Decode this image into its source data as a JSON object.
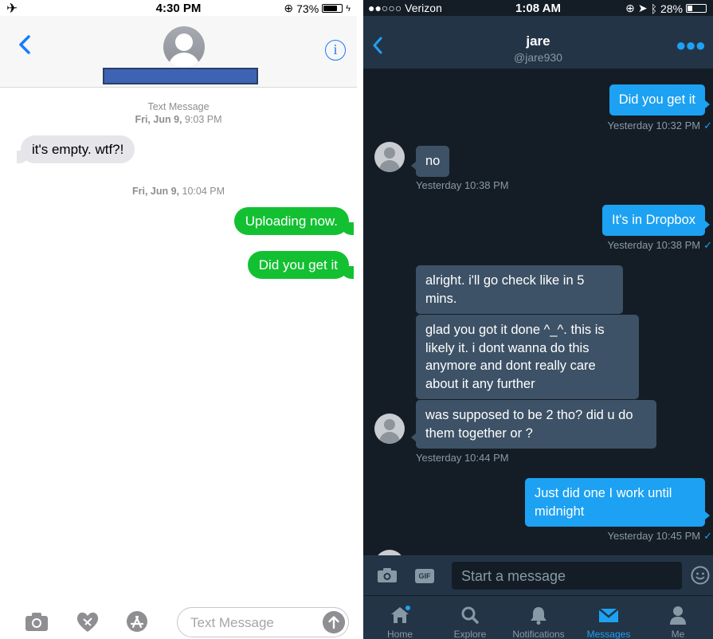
{
  "left": {
    "status": {
      "time": "4:30 PM",
      "battery": "73%",
      "battery_level": 0.73
    },
    "thread_header": "Text Message",
    "messages": [
      {
        "meta_day": "Fri, Jun 9,",
        "meta_time": "9:03 PM"
      },
      {
        "text": "it's empty. wtf?!",
        "direction": "incoming"
      },
      {
        "meta_day": "Fri, Jun 9,",
        "meta_time": "10:04 PM"
      },
      {
        "text": "Uploading now.",
        "direction": "outgoing"
      },
      {
        "text": "Did you get it",
        "direction": "outgoing"
      }
    ],
    "input_placeholder": "Text Message",
    "icons": [
      "camera-icon",
      "digital-touch-icon",
      "app-store-icon",
      "send-arrow-icon",
      "info-icon",
      "back-chevron-icon"
    ],
    "colors": {
      "accent": "#157efb",
      "outgoing": "#13c032",
      "incoming": "#e5e5ea"
    }
  },
  "right": {
    "status": {
      "carrier": "●●○○○ Verizon",
      "time": "1:08 AM",
      "battery": "28%",
      "battery_level": 0.28
    },
    "contact": {
      "name": "jare",
      "handle": "@jare930"
    },
    "messages": [
      {
        "text": "Did you get it",
        "direction": "outgoing",
        "time": "Yesterday 10:32 PM"
      },
      {
        "text": "no",
        "direction": "incoming",
        "time": "Yesterday 10:38 PM"
      },
      {
        "text": "It's in Dropbox",
        "direction": "outgoing",
        "time": "Yesterday 10:38 PM"
      },
      {
        "text": "alright. i'll go check like in 5 mins.",
        "direction": "incoming"
      },
      {
        "text": "glad you got it done ^_^. this is likely it. i dont wanna do this anymore and dont really care about it any further",
        "direction": "incoming"
      },
      {
        "text": "was supposed to be 2 tho? did u do them together or ?",
        "direction": "incoming",
        "time": "Yesterday 10:44 PM"
      },
      {
        "text": "Just did one I work until midnight",
        "direction": "outgoing",
        "time": "Yesterday 10:45 PM"
      }
    ],
    "composer": {
      "placeholder": "Start a message",
      "gif_label": "GIF"
    },
    "tabs": [
      {
        "label": "Home",
        "icon": "home-icon"
      },
      {
        "label": "Explore",
        "icon": "search-icon"
      },
      {
        "label": "Notifications",
        "icon": "bell-icon"
      },
      {
        "label": "Messages",
        "icon": "envelope-icon",
        "active": true
      },
      {
        "label": "Me",
        "icon": "person-icon"
      }
    ],
    "colors": {
      "background": "#141d26",
      "bar": "#243447",
      "accent": "#1da1f2",
      "incoming": "#3d5266"
    }
  }
}
